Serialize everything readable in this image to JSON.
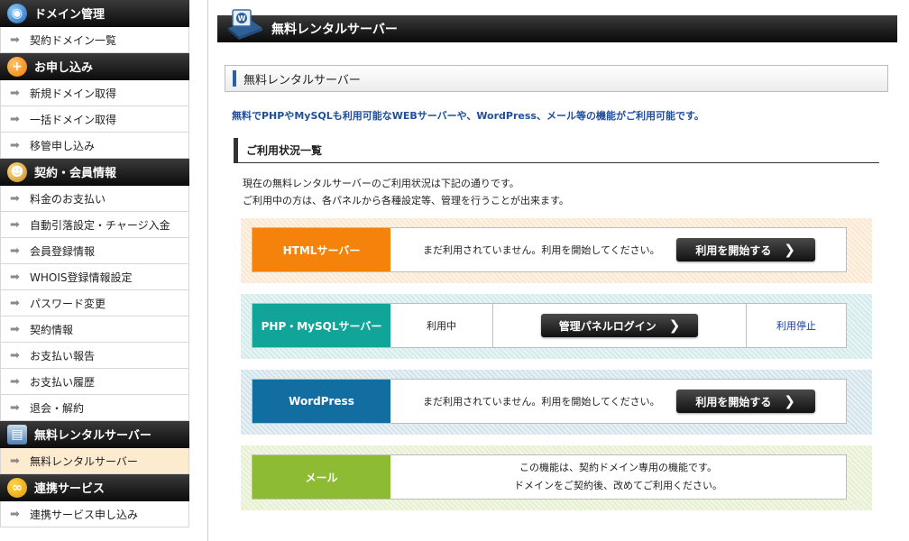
{
  "sidebar": {
    "sections": [
      {
        "title": "ドメイン管理",
        "icon": "globe-icon",
        "items": [
          "契約ドメイン一覧"
        ]
      },
      {
        "title": "お申し込み",
        "icon": "plus-icon",
        "items": [
          "新規ドメイン取得",
          "一括ドメイン取得",
          "移管申し込み"
        ]
      },
      {
        "title": "契約・会員情報",
        "icon": "person-icon",
        "items": [
          "料金のお支払い",
          "自動引落設定・チャージ入金",
          "会員登録情報",
          "WHOIS登録情報設定",
          "パスワード変更",
          "契約情報",
          "お支払い報告",
          "お支払い履歴",
          "退会・解約"
        ]
      },
      {
        "title": "無料レンタルサーバー",
        "icon": "server-icon",
        "items": [
          "無料レンタルサーバー"
        ]
      },
      {
        "title": "連携サービス",
        "icon": "link-icon",
        "items": [
          "連携サービス申し込み"
        ]
      }
    ]
  },
  "main": {
    "page_title": "無料レンタルサーバー",
    "section_title": "無料レンタルサーバー",
    "intro": "無料でPHPやMySQLも利用可能なWEBサーバーや、WordPress、メール等の機能がご利用可能です。",
    "status_heading": "ご利用状況一覧",
    "desc_line1": "現在の無料レンタルサーバーのご利用状況は下記の通りです。",
    "desc_line2": "ご利用中の方は、各パネルから各種設定等、管理を行うことが出来ます。",
    "services": {
      "html": {
        "label": "HTMLサーバー",
        "message": "まだ利用されていません。利用を開始してください。",
        "button": "利用を開始する"
      },
      "php": {
        "label": "PHP・MySQLサーバー",
        "status": "利用中",
        "button": "管理パネルログイン",
        "stop_link": "利用停止"
      },
      "wordpress": {
        "label": "WordPress",
        "message": "まだ利用されていません。利用を開始してください。",
        "button": "利用を開始する"
      },
      "mail": {
        "label": "メール",
        "line1": "この機能は、契約ドメイン専用の機能です。",
        "line2": "ドメインをご契約後、改めてご利用ください。"
      }
    }
  },
  "colors": {
    "html": "#f5820b",
    "php": "#11a59a",
    "wordpress": "#126ea0",
    "mail": "#8dbb33",
    "active_item": "#fdebcf"
  }
}
